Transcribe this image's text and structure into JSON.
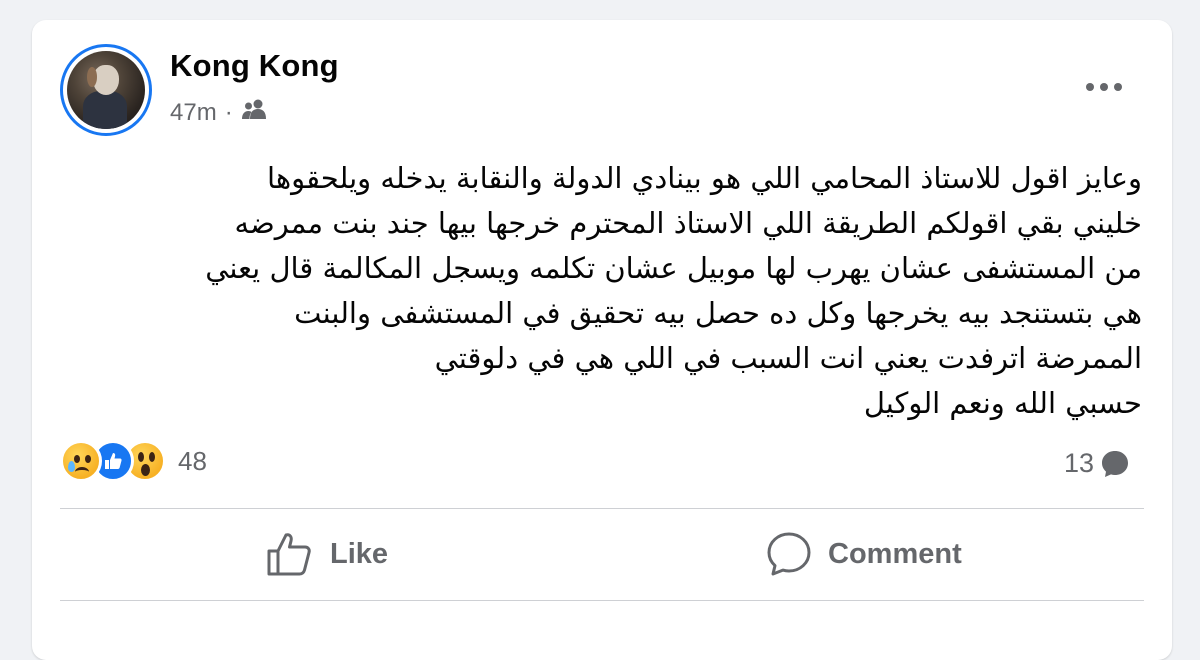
{
  "post": {
    "author": "Kong Kong",
    "time": "47m",
    "separator": "·",
    "audience_icon": "friends-icon",
    "lines": [
      "وعايز اقول للاستاذ المحامي اللي هو بينادي الدولة والنقابة يدخله ويلحقوها",
      "خليني بقي اقولكم الطريقة اللي الاستاذ المحترم خرجها بيها جند بنت ممرضه",
      "من المستشفى عشان يهرب لها موبيل عشان تكلمه ويسجل المكالمة قال يعني",
      "هي بتستنجد بيه يخرجها وكل ده حصل بيه تحقيق في المستشفى والبنت",
      "الممرضة اترفدت يعني انت السبب في اللي هي في دلوقتي",
      "حسبي الله ونعم الوكيل"
    ]
  },
  "reactions": {
    "types": [
      "sad",
      "like",
      "wow"
    ],
    "count": "48"
  },
  "comments": {
    "count": "13"
  },
  "actions": {
    "like_label": "Like",
    "comment_label": "Comment"
  },
  "colors": {
    "accent": "#1877f2",
    "text": "#050505",
    "secondary": "#65676b"
  }
}
